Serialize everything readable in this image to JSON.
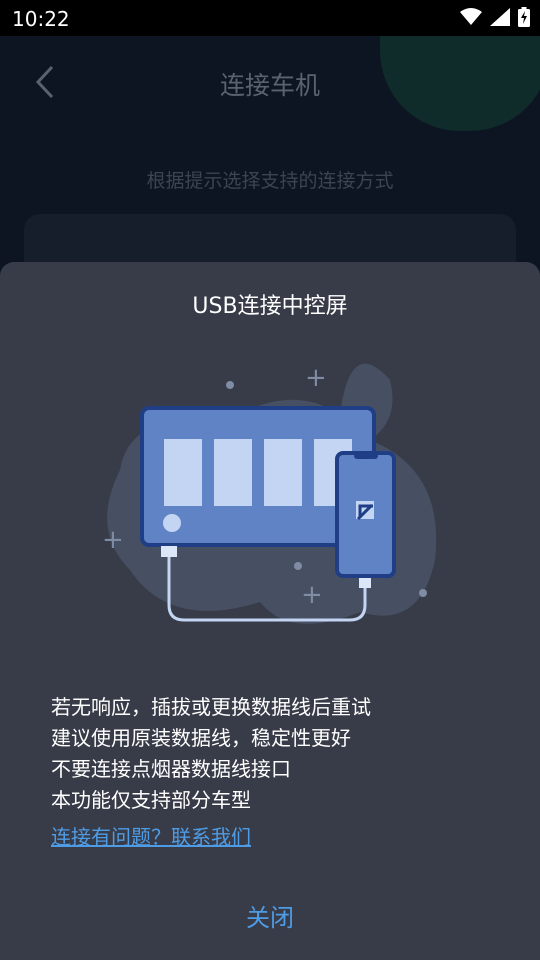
{
  "status_bar": {
    "time": "10:22",
    "icons": [
      "wifi-icon",
      "signal-icon",
      "battery-charging-icon"
    ]
  },
  "background_page": {
    "title": "连接车机",
    "subtitle": "根据提示选择支持的连接方式",
    "back_icon": "chevron-left-icon"
  },
  "dialog": {
    "title": "USB连接中控屏",
    "tips": [
      "若无响应，插拔或更换数据线后重试",
      "建议使用原装数据线，稳定性更好",
      "不要连接点烟器数据线接口",
      "本功能仅支持部分车型"
    ],
    "help_link": "连接有问题？联系我们",
    "close_label": "关闭"
  },
  "colors": {
    "sheet_bg": "#383c48",
    "accent_link": "#4f9ce6",
    "illustration_blue": "#5f83c4",
    "illustration_light": "#c3d5f2"
  }
}
